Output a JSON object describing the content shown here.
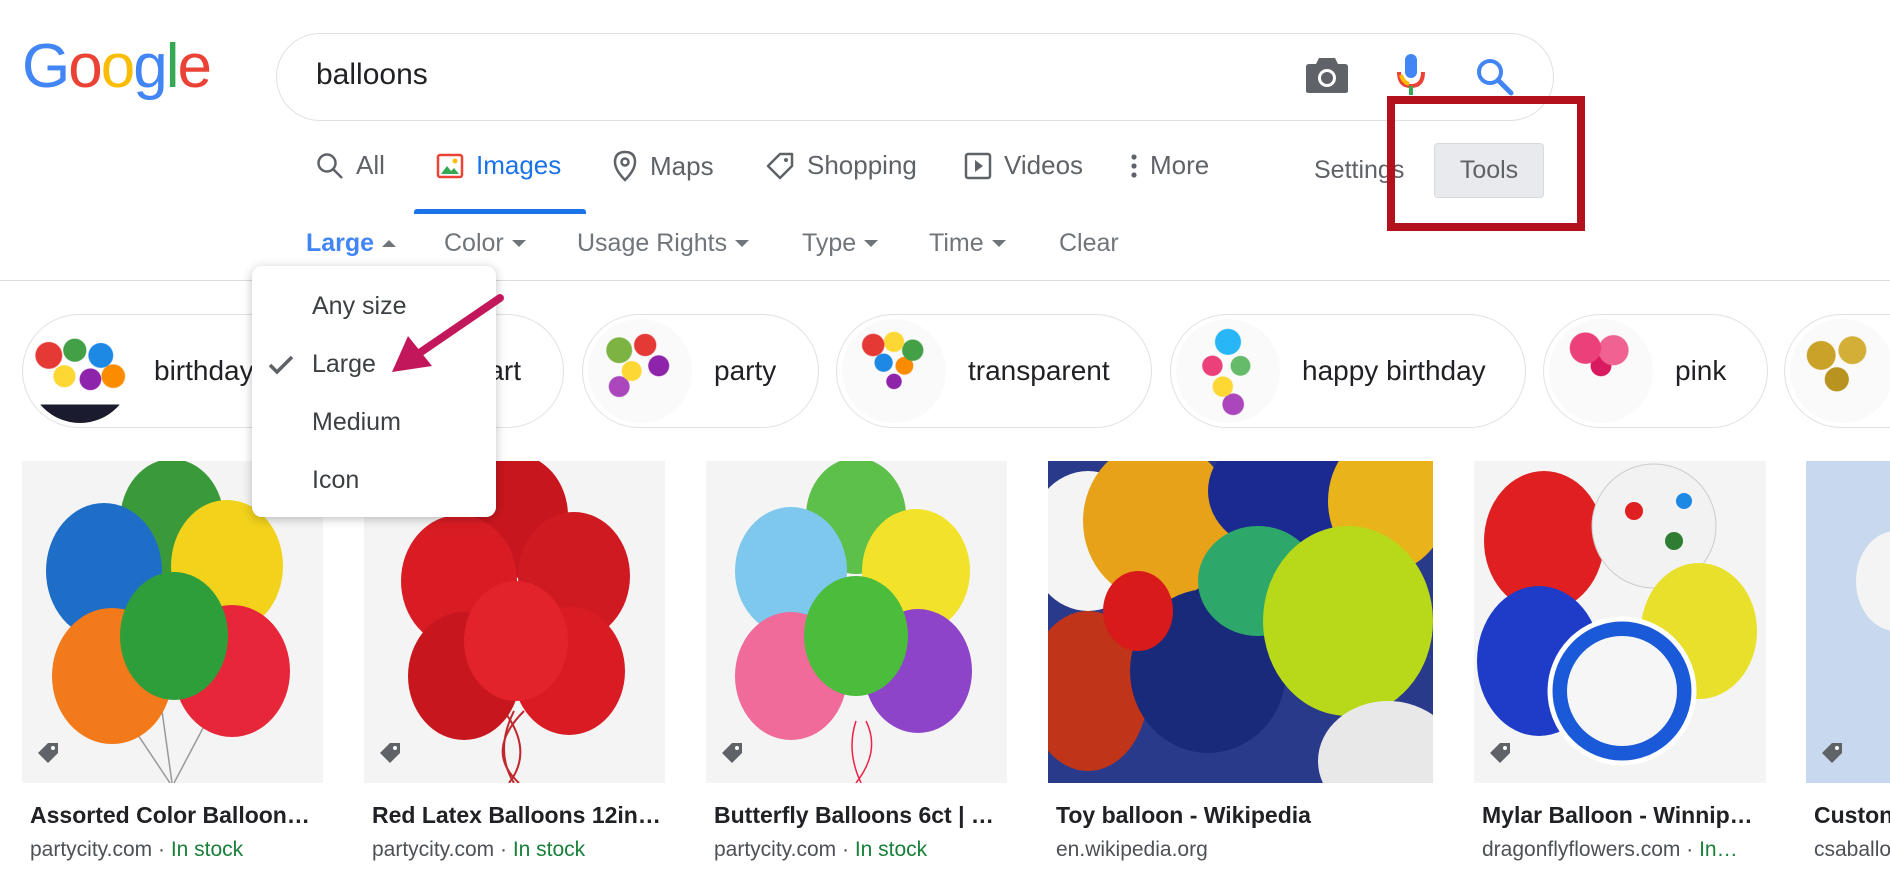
{
  "search": {
    "query": "balloons"
  },
  "logo": {
    "letters": [
      "G",
      "o",
      "o",
      "g",
      "l",
      "e"
    ],
    "colors": [
      "#4285f4",
      "#ea4335",
      "#fbbc05",
      "#4285f4",
      "#34a853",
      "#ea4335"
    ]
  },
  "tabs": [
    {
      "label": "All",
      "icon": "search-icon"
    },
    {
      "label": "Images",
      "icon": "image-icon",
      "active": true
    },
    {
      "label": "Maps",
      "icon": "map-pin-icon"
    },
    {
      "label": "Shopping",
      "icon": "tag-icon"
    },
    {
      "label": "Videos",
      "icon": "play-icon"
    },
    {
      "label": "More",
      "icon": "more-vert-icon"
    }
  ],
  "settings_label": "Settings",
  "tools_label": "Tools",
  "filters": [
    {
      "label": "Large",
      "active": true
    },
    {
      "label": "Color"
    },
    {
      "label": "Usage Rights"
    },
    {
      "label": "Type"
    },
    {
      "label": "Time"
    },
    {
      "label": "Clear"
    }
  ],
  "size_menu": {
    "items": [
      "Any size",
      "Large",
      "Medium",
      "Icon"
    ],
    "selected": "Large"
  },
  "chips": [
    {
      "label": "birthday"
    },
    {
      "label": "art"
    },
    {
      "label": "party"
    },
    {
      "label": "transparent"
    },
    {
      "label": "happy birthday"
    },
    {
      "label": "pink"
    },
    {
      "label": ""
    }
  ],
  "results": [
    {
      "title": "Assorted Color Balloon…",
      "source": "partycity.com",
      "sep": " · ",
      "stock": "In stock"
    },
    {
      "title": "Red Latex Balloons 12in…",
      "source": "partycity.com",
      "sep": " · ",
      "stock": "In stock"
    },
    {
      "title": "Butterfly Balloons 6ct | …",
      "source": "partycity.com",
      "sep": " · ",
      "stock": "In stock"
    },
    {
      "title": "Toy balloon - Wikipedia",
      "source": "en.wikipedia.org",
      "sep": "",
      "stock": ""
    },
    {
      "title": "Mylar Balloon - Winnip…",
      "source": "dragonflyflowers.com",
      "sep": " · ",
      "stock": "In…"
    },
    {
      "title": "Custon",
      "source": "csaballo",
      "sep": "",
      "stock": ""
    }
  ],
  "colors": {
    "accent": "#1a73e8",
    "highlight_box": "#b3121c",
    "arrow": "#c2185b",
    "stock_green": "#188038"
  }
}
